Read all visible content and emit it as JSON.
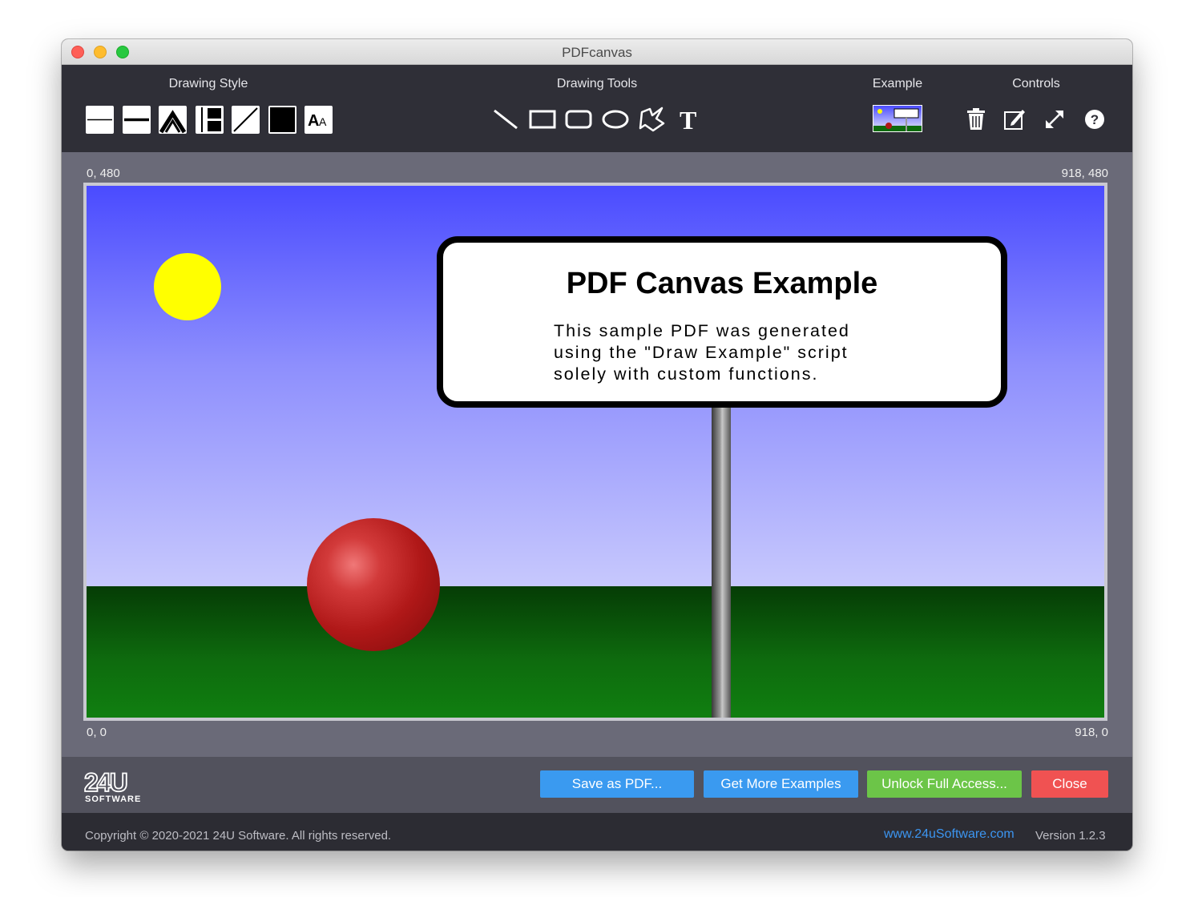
{
  "window": {
    "title": "PDFcanvas"
  },
  "toolbar": {
    "sections": {
      "drawing_style": "Drawing Style",
      "drawing_tools": "Drawing Tools",
      "example": "Example",
      "controls": "Controls"
    },
    "style_buttons": [
      "thin-line-style",
      "thick-line-style",
      "line-join-style",
      "line-cap-style",
      "stroke-style",
      "fill-color-style",
      "font-style"
    ],
    "style_font_glyph": "AA",
    "tools": [
      "line-tool",
      "rectangle-tool",
      "rounded-rectangle-tool",
      "oval-tool",
      "polygon-tool",
      "text-tool"
    ],
    "text_tool_glyph": "T",
    "controls": [
      "trash-icon",
      "edit-icon",
      "expand-icon",
      "help-icon"
    ]
  },
  "canvas": {
    "coord_top_left": "0, 480",
    "coord_top_right": "918, 480",
    "coord_bottom_left": "0, 0",
    "coord_bottom_right": "918, 0",
    "sign_title": "PDF Canvas Example",
    "sign_body": "This sample PDF was generated\nusing the \"Draw Example\" script\nsolely with custom functions.",
    "colors": {
      "sky_top": "#4a4bff",
      "sky_bottom": "#c7c8fd",
      "ground": "#0e6b0e",
      "sun": "#ffff00",
      "ball": "#b01818"
    }
  },
  "actions": {
    "save_pdf": "Save as PDF...",
    "more_examples": "Get More Examples",
    "unlock": "Unlock Full Access...",
    "close": "Close",
    "colors": {
      "save_pdf": "#3a9af0",
      "more_examples": "#3a9af0",
      "unlock": "#6cc548",
      "close": "#f05252"
    }
  },
  "footer": {
    "copyright": "Copyright © 2020-2021 24U Software. All rights reserved.",
    "website": "www.24uSoftware.com",
    "version": "Version 1.2.3"
  }
}
